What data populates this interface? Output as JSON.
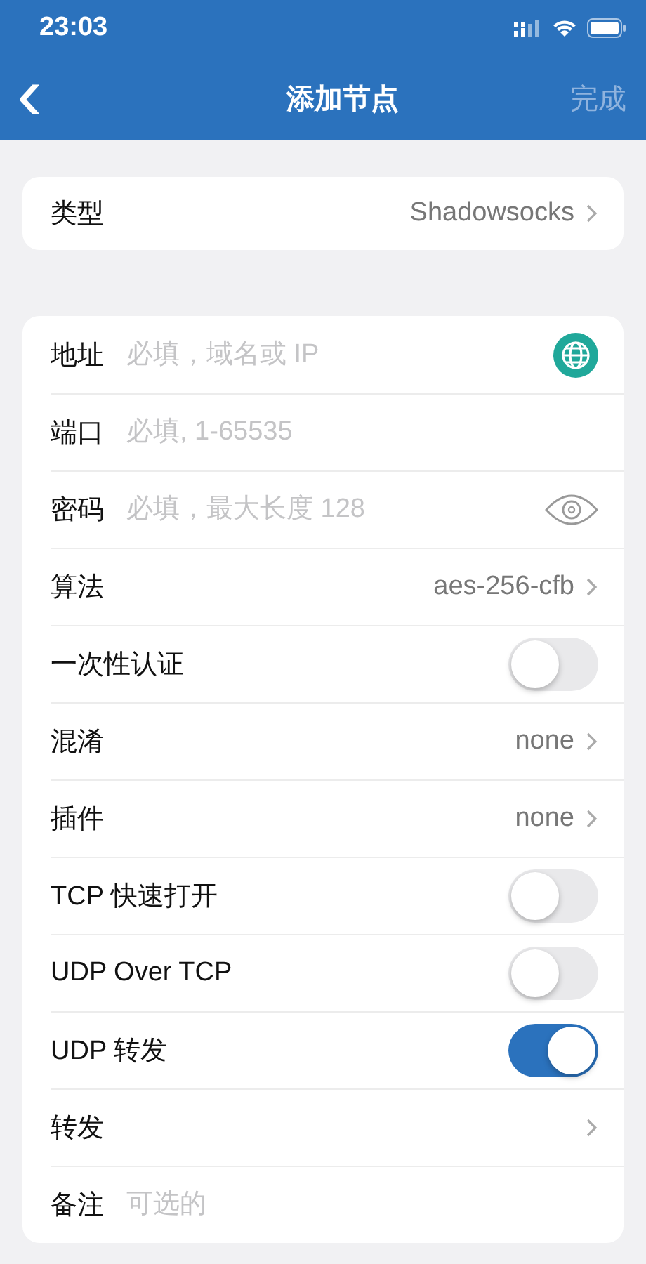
{
  "status_bar": {
    "time": "23:03"
  },
  "nav": {
    "back": "‹",
    "title": "添加节点",
    "done": "完成",
    "done_disabled": true
  },
  "type_card": {
    "label": "类型",
    "value": "Shadowsocks"
  },
  "rows": [
    {
      "kind": "address",
      "label": "地址",
      "placeholder": "必填，域名或 IP"
    },
    {
      "kind": "field",
      "label": "端口",
      "placeholder": "必填, 1-65535"
    },
    {
      "kind": "password",
      "label": "密码",
      "placeholder": "必填，最大长度 128"
    },
    {
      "kind": "select",
      "label": "算法",
      "value": "aes-256-cfb"
    },
    {
      "kind": "toggle",
      "label": "一次性认证",
      "on": false
    },
    {
      "kind": "select",
      "label": "混淆",
      "value": "none"
    },
    {
      "kind": "select",
      "label": "插件",
      "value": "none"
    },
    {
      "kind": "toggle",
      "label": "TCP 快速打开",
      "on": false
    },
    {
      "kind": "toggle",
      "label": "UDP Over TCP",
      "on": false
    },
    {
      "kind": "toggle",
      "label": "UDP 转发",
      "on": true
    },
    {
      "kind": "select",
      "label": "转发"
    },
    {
      "kind": "field",
      "label": "备注",
      "placeholder": "可选的"
    }
  ]
}
